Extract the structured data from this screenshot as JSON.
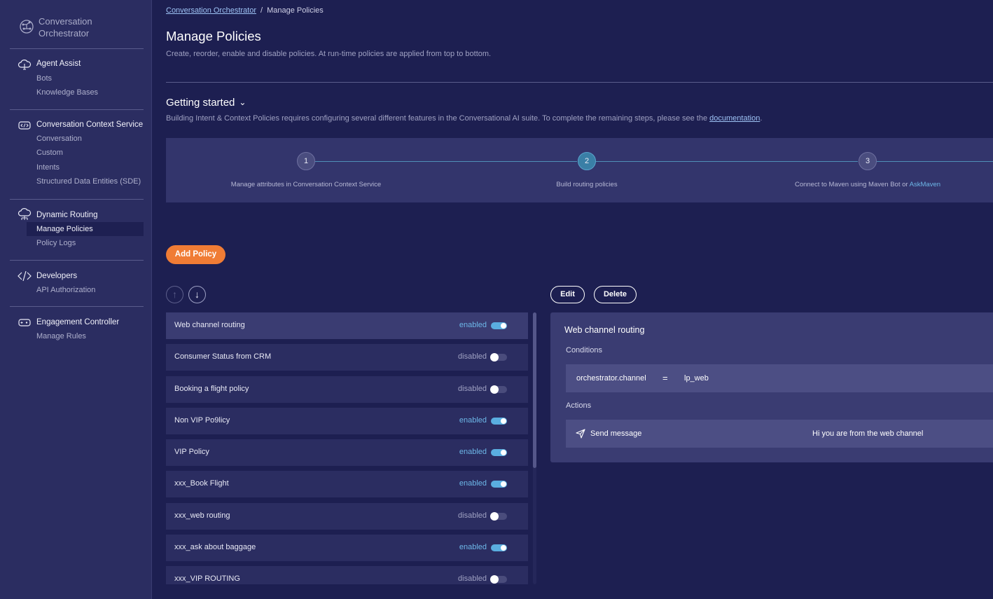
{
  "brand": {
    "line1": "Conversation",
    "line2": "Orchestrator"
  },
  "sidebar": {
    "sections": [
      {
        "title": "Agent Assist",
        "icon": "cloud-brain-icon",
        "items": [
          "Bots",
          "Knowledge Bases"
        ]
      },
      {
        "title": "Conversation Context Service",
        "icon": "code-chat-icon",
        "items": [
          "Conversation",
          "Custom",
          "Intents",
          "Structured Data Entities (SDE)"
        ]
      },
      {
        "title": "Dynamic Routing",
        "icon": "cloud-routing-icon",
        "items": [
          "Manage Policies",
          "Policy Logs"
        ],
        "active_item": "Manage Policies"
      },
      {
        "title": "Developers",
        "icon": "code-brackets-icon",
        "items": [
          "API Authorization"
        ]
      },
      {
        "title": "Engagement Controller",
        "icon": "controller-icon",
        "items": [
          "Manage Rules"
        ]
      }
    ]
  },
  "breadcrumb": {
    "parent": "Conversation Orchestrator",
    "separator": "/",
    "current": "Manage Policies"
  },
  "page": {
    "title": "Manage Policies",
    "description": "Create, reorder, enable and disable policies. At run-time policies are applied from top to bottom."
  },
  "getting_started": {
    "title": "Getting started",
    "description_prefix": "Building Intent & Context Policies requires configuring several different features in the Conversational AI suite. To complete the remaining steps, please see the ",
    "doc_link": "documentation",
    "description_suffix": ".",
    "steps": [
      {
        "number": "1",
        "label": "Manage attributes in Conversation Context Service"
      },
      {
        "number": "2",
        "label": "Build routing policies",
        "current": true
      },
      {
        "number": "3",
        "label": "Connect to Maven using Maven Bot or ",
        "link": "AskMaven"
      }
    ]
  },
  "actions": {
    "add_policy": "Add Policy",
    "move_up": "↑",
    "move_down": "↓",
    "edit": "Edit",
    "delete": "Delete"
  },
  "policies": [
    {
      "name": "Web channel routing",
      "status": "enabled",
      "enabled": true,
      "selected": true
    },
    {
      "name": "Consumer Status from CRM",
      "status": "disabled",
      "enabled": false
    },
    {
      "name": "Booking a flight policy",
      "status": "disabled",
      "enabled": false
    },
    {
      "name": "Non VIP Po9licy",
      "status": "enabled",
      "enabled": true
    },
    {
      "name": "VIP Policy",
      "status": "enabled",
      "enabled": true
    },
    {
      "name": "xxx_Book Flight",
      "status": "enabled",
      "enabled": true
    },
    {
      "name": "xxx_web routing",
      "status": "disabled",
      "enabled": false
    },
    {
      "name": "xxx_ask about baggage",
      "status": "enabled",
      "enabled": true
    },
    {
      "name": "xxx_VIP ROUTING",
      "status": "disabled",
      "enabled": false
    }
  ],
  "detail": {
    "title": "Web channel routing",
    "conditions_label": "Conditions",
    "condition": {
      "key": "orchestrator.channel",
      "operator": "=",
      "value": "lp_web"
    },
    "actions_label": "Actions",
    "action": {
      "icon": "send-icon",
      "name": "Send message",
      "message": "Hi you are from the web channel"
    }
  },
  "colors": {
    "background": "#1d1f51",
    "sidebar": "#2b2d61",
    "accent_orange": "#f07c35",
    "toggle_on": "#5aaee0",
    "link": "#9ec3f5"
  }
}
